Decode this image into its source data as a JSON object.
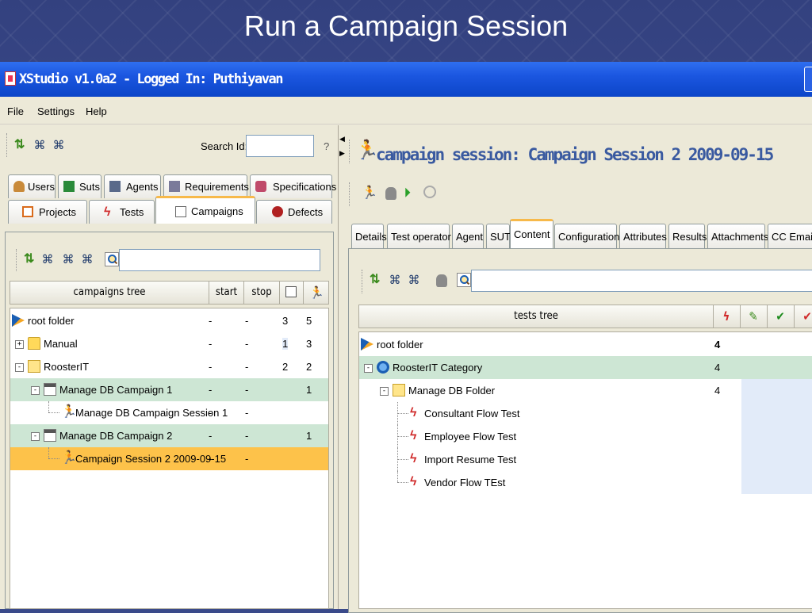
{
  "slide": {
    "title": "Run a Campaign Session"
  },
  "window": {
    "title": "XStudio v1.0a2 - Logged In: Puthiyavan"
  },
  "menu": {
    "items": [
      "File",
      "Settings",
      "Help"
    ]
  },
  "left": {
    "search_label": "Search Id:",
    "search_value": "",
    "help": "?",
    "tabs_row1": [
      "Users",
      "Suts",
      "Agents",
      "Requirements",
      "Specifications"
    ],
    "tabs_row2": [
      "Projects",
      "Tests",
      "Campaigns",
      "Defects"
    ],
    "active_tab": "Campaigns",
    "filter_value": "",
    "table": {
      "columns": [
        "campaigns tree",
        "start",
        "stop"
      ],
      "rows": [
        {
          "name": "root folder",
          "start": "-",
          "stop": "-",
          "c1": "3",
          "c2": "5",
          "icon": "root-folder-icon"
        },
        {
          "name": "Manual",
          "start": "-",
          "stop": "-",
          "c1": "1",
          "c2": "3",
          "icon": "folder-icon",
          "toggle": "+"
        },
        {
          "name": "RoosterIT",
          "start": "-",
          "stop": "-",
          "c1": "2",
          "c2": "2",
          "icon": "folder-open-icon",
          "toggle": "-"
        },
        {
          "name": "Manage DB Campaign 1",
          "start": "-",
          "stop": "-",
          "c1": "",
          "c2": "1",
          "icon": "campaign-icon",
          "toggle": "-"
        },
        {
          "name": "Manage DB Campaign Session 1",
          "start": "-",
          "stop": "-",
          "c1": "",
          "c2": "",
          "icon": "session-runner-icon"
        },
        {
          "name": "Manage DB Campaign 2",
          "start": "-",
          "stop": "-",
          "c1": "",
          "c2": "1",
          "icon": "campaign-icon",
          "toggle": "-"
        },
        {
          "name": "Campaign Session 2 2009-09-15",
          "start": "-",
          "stop": "-",
          "c1": "",
          "c2": "",
          "icon": "session-runner-icon"
        }
      ]
    }
  },
  "right": {
    "title": "campaign session: Campaign Session 2 2009-09-15",
    "tabs": [
      "Details",
      "Test operator",
      "Agent",
      "SUT",
      "Content",
      "Configuration",
      "Attributes",
      "Results",
      "Attachments",
      "CC Emails"
    ],
    "active_tab": "Content",
    "filter_value": "",
    "table": {
      "columns": [
        "tests tree"
      ],
      "rows": [
        {
          "name": "root folder",
          "count": "4",
          "icon": "root-folder-icon"
        },
        {
          "name": "RoosterIT Category",
          "count": "4",
          "icon": "category-icon",
          "toggle": "-"
        },
        {
          "name": "Manage DB Folder",
          "count": "4",
          "icon": "folder-open-icon",
          "toggle": "-"
        },
        {
          "name": "Consultant Flow Test",
          "count": "",
          "icon": "test-icon"
        },
        {
          "name": "Employee Flow Test",
          "count": "",
          "icon": "test-icon"
        },
        {
          "name": "Import Resume Test",
          "count": "",
          "icon": "test-icon"
        },
        {
          "name": "Vendor Flow TEst",
          "count": "",
          "icon": "test-icon"
        }
      ]
    }
  },
  "colors": {
    "title_bar": "#1b56e0",
    "selected_row": "#fdc24a",
    "green_row": "#cde6d4",
    "tab_highlight": "#f7b94a"
  }
}
